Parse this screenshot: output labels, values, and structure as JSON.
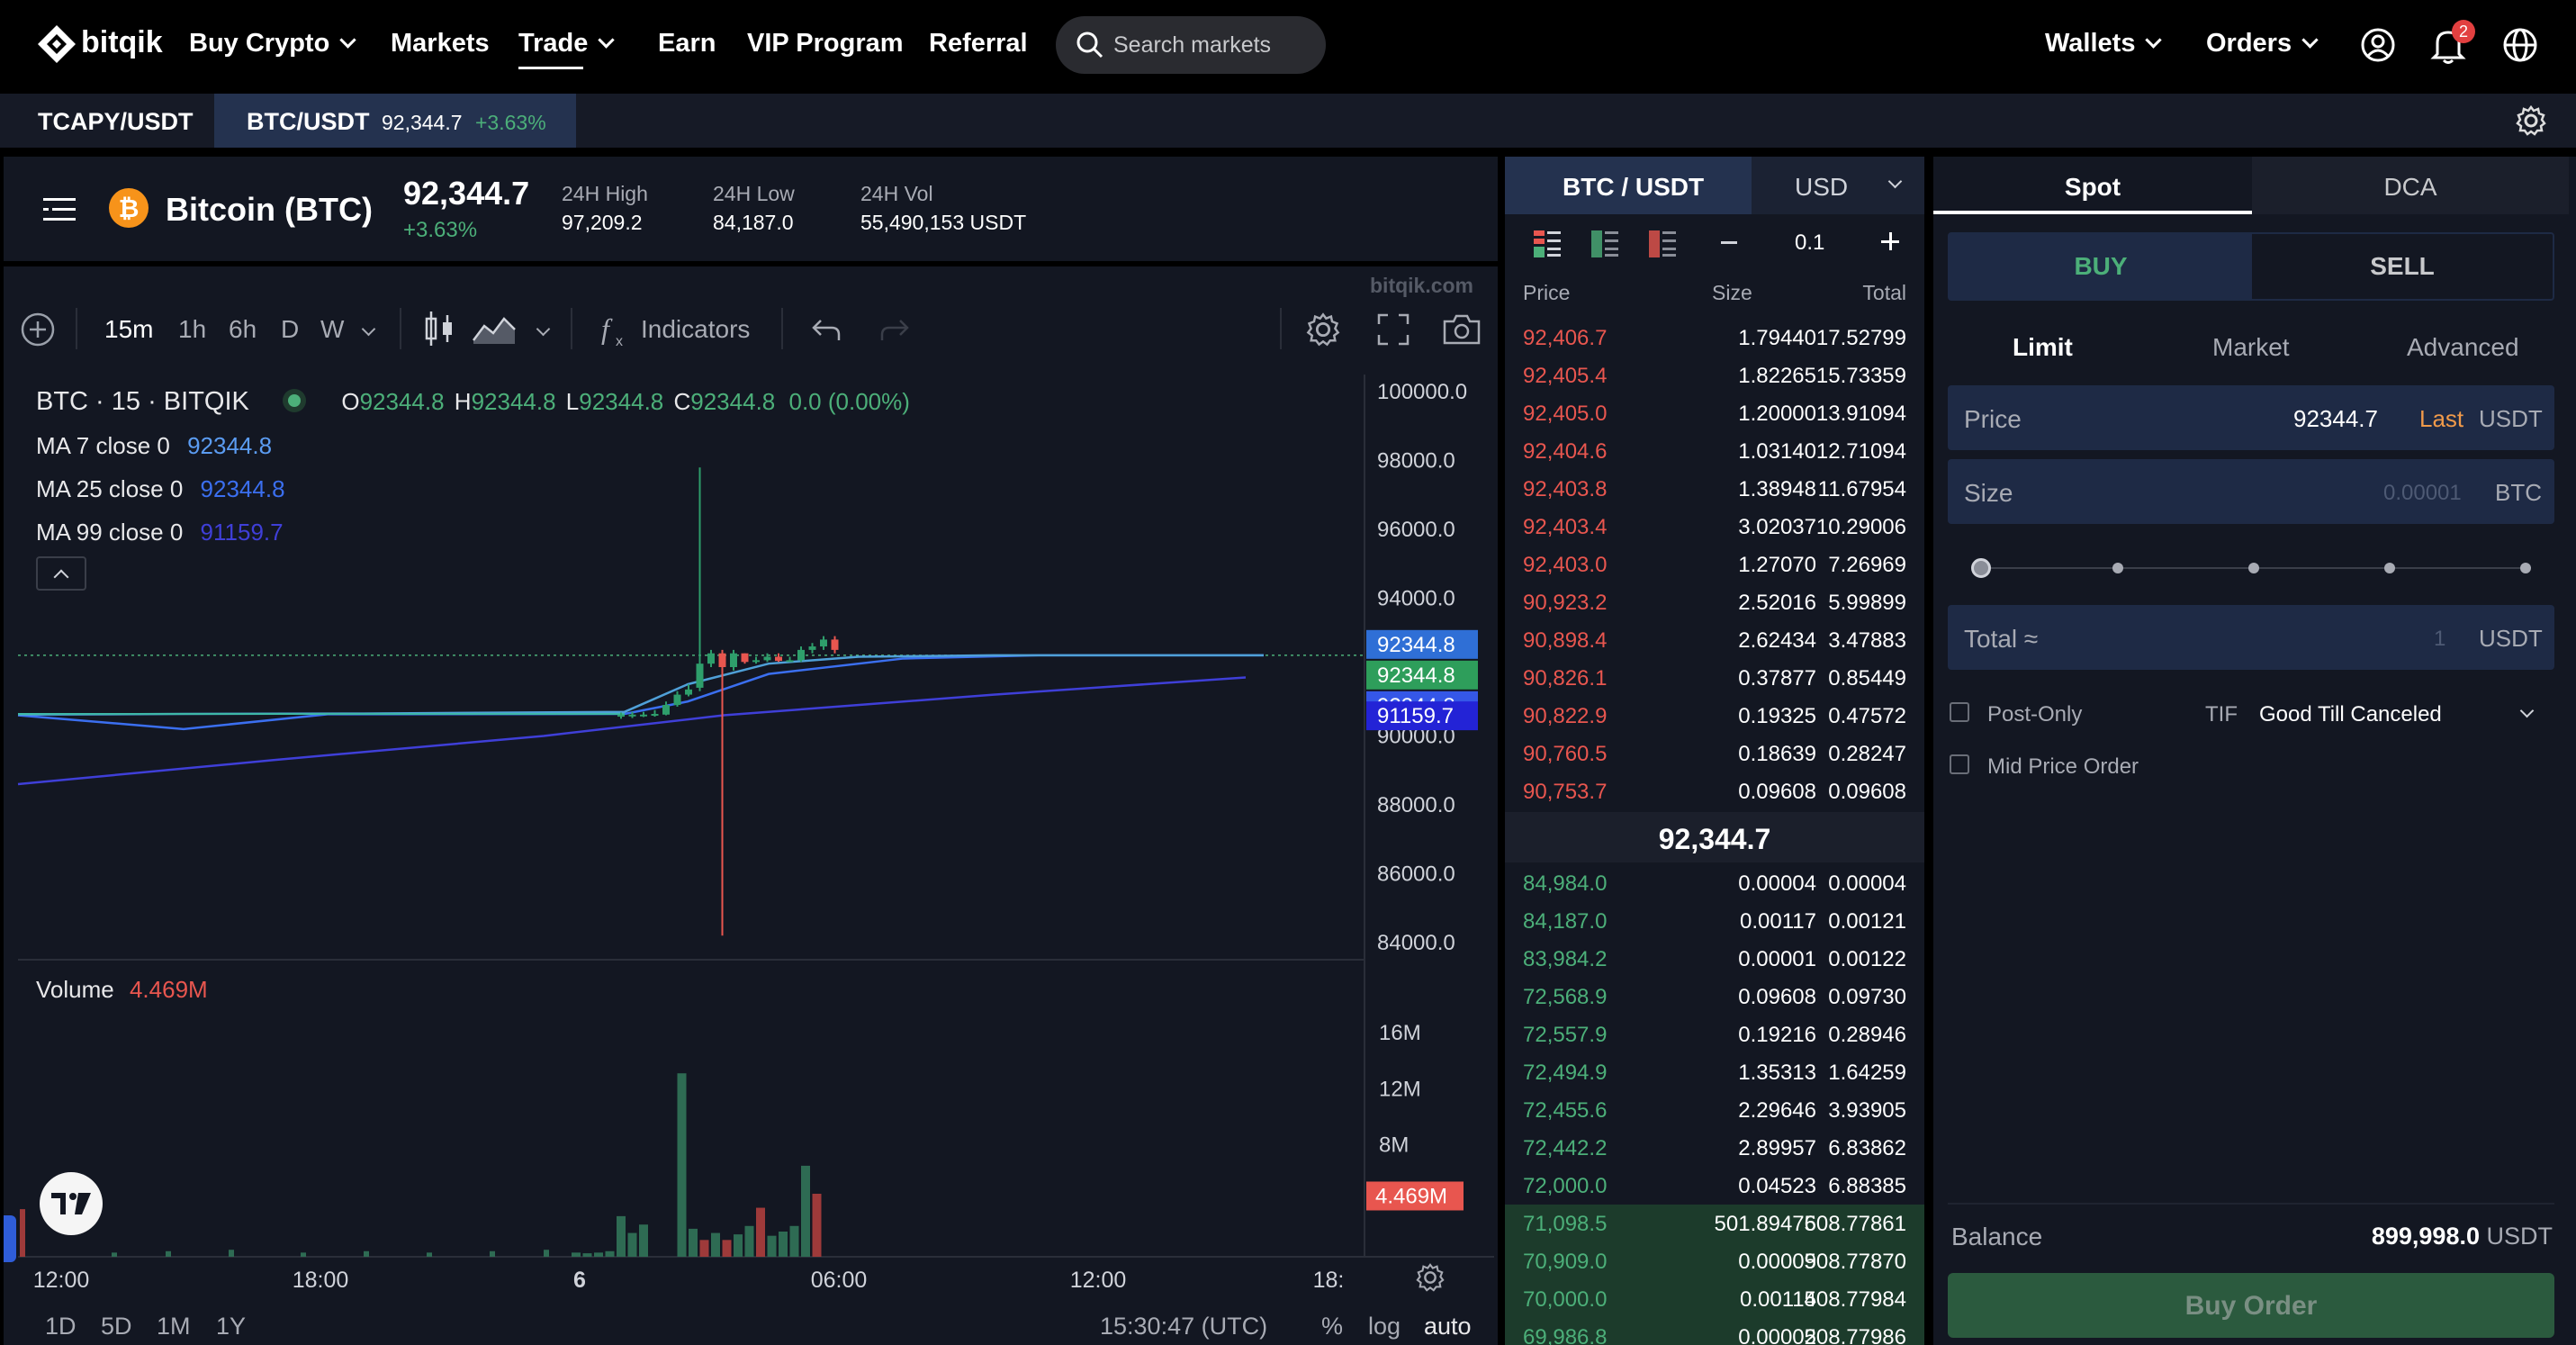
{
  "nav": {
    "logo": "bitqik",
    "items": [
      "Buy Crypto",
      "Markets",
      "Trade",
      "Earn",
      "VIP Program",
      "Referral"
    ],
    "search_placeholder": "Search markets",
    "wallets": "Wallets",
    "orders": "Orders",
    "notification_count": "2"
  },
  "tickers": [
    {
      "symbol": "TCAPY/USDT"
    },
    {
      "symbol": "BTC/USDT",
      "price": "92,344.7",
      "change": "+3.63%"
    }
  ],
  "market": {
    "name": "Bitcoin (BTC)",
    "price": "92,344.7",
    "change": "+3.63%",
    "high_label": "24H High",
    "high": "97,209.2",
    "low_label": "24H Low",
    "low": "84,187.0",
    "vol_label": "24H Vol",
    "vol": "55,490,153 USDT",
    "watermark": "bitqik.com"
  },
  "toolbar": {
    "intervals": [
      "15m",
      "1h",
      "6h",
      "D",
      "W"
    ],
    "indicators": "Indicators"
  },
  "legend": {
    "symbol": "BTC · 15 · BITQIK",
    "o_label": "O",
    "o": "92344.8",
    "h_label": "H",
    "h": "92344.8",
    "l_label": "L",
    "l": "92344.8",
    "c_label": "C",
    "c": "92344.8",
    "chg": "0.0 (0.00%)",
    "ma": [
      {
        "label": "MA 7 close 0",
        "value": "92344.8",
        "color": "#5b9cf2"
      },
      {
        "label": "MA 25 close 0",
        "value": "92344.8",
        "color": "#3b6ff0"
      },
      {
        "label": "MA 99 close 0",
        "value": "91159.7",
        "color": "#3f3fd8"
      }
    ],
    "volume_label": "Volume",
    "volume_value": "4.469M"
  },
  "chart_data": {
    "type": "candlestick",
    "y_ticks": [
      "100000.0",
      "98000.0",
      "96000.0",
      "94000.0",
      "90000.0",
      "88000.0",
      "86000.0",
      "84000.0"
    ],
    "ylim": [
      83500,
      100500
    ],
    "price_tags": [
      {
        "value": "92344.8",
        "color": "#2f6fd6"
      },
      {
        "value": "92344.8",
        "color": "#2e9e5b"
      },
      {
        "value": "92344.8",
        "color": "#3557e8"
      },
      {
        "value": "91159.7",
        "color": "#2323d6"
      }
    ],
    "x_ticks": [
      "12:00",
      "18:00",
      "6",
      "06:00",
      "12:00",
      "18:"
    ],
    "volume_ticks": [
      "16M",
      "12M",
      "8M"
    ],
    "volume_tag": "4.469M",
    "candles_close": [
      90620,
      90620,
      90620,
      90640,
      90900,
      91200,
      91350,
      92100,
      92400,
      92000,
      92400,
      92150,
      92200,
      92300,
      92180,
      92200,
      92500,
      92600,
      92800,
      92500
    ],
    "candles_open": [
      90560,
      90580,
      90600,
      90640,
      90620,
      90900,
      91200,
      91400,
      92100,
      92400,
      92000,
      92400,
      92150,
      92200,
      92300,
      92180,
      92200,
      92500,
      92600,
      92800
    ],
    "candles_high": [
      90680,
      90700,
      90700,
      90750,
      91000,
      91300,
      91500,
      97800,
      92500,
      92500,
      92500,
      92400,
      92300,
      92400,
      92400,
      92300,
      92600,
      92700,
      92900,
      92900
    ],
    "candles_low": [
      90500,
      90520,
      90550,
      90560,
      90600,
      90850,
      91150,
      91300,
      92000,
      84200,
      91900,
      92100,
      92100,
      92150,
      92150,
      92150,
      92150,
      92400,
      92500,
      92400
    ],
    "volumes": [
      0.3,
      0.25,
      0.3,
      0.4,
      2.9,
      1.7,
      2.3,
      13.1,
      2.0,
      1.2,
      1.7,
      1.2,
      1.6,
      2.2,
      3.5,
      1.5,
      1.8,
      2.2,
      6.5,
      4.5
    ]
  },
  "bottom_bar": {
    "ranges": [
      "1D",
      "5D",
      "1M",
      "1Y"
    ],
    "time": "15:30:47 (UTC)",
    "pct": "%",
    "log": "log",
    "auto": "auto"
  },
  "orderbook": {
    "pair": "BTC / USDT",
    "currency": "USD",
    "step": "0.1",
    "headers": [
      "Price",
      "Size",
      "Total"
    ],
    "asks": [
      [
        "92,406.7",
        "1.79440",
        "17.52799"
      ],
      [
        "92,405.4",
        "1.82265",
        "15.73359"
      ],
      [
        "92,405.0",
        "1.20000",
        "13.91094"
      ],
      [
        "92,404.6",
        "1.03140",
        "12.71094"
      ],
      [
        "92,403.8",
        "1.38948",
        "11.67954"
      ],
      [
        "92,403.4",
        "3.02037",
        "10.29006"
      ],
      [
        "92,403.0",
        "1.27070",
        "7.26969"
      ],
      [
        "90,923.2",
        "2.52016",
        "5.99899"
      ],
      [
        "90,898.4",
        "2.62434",
        "3.47883"
      ],
      [
        "90,826.1",
        "0.37877",
        "0.85449"
      ],
      [
        "90,822.9",
        "0.19325",
        "0.47572"
      ],
      [
        "90,760.5",
        "0.18639",
        "0.28247"
      ],
      [
        "90,753.7",
        "0.09608",
        "0.09608"
      ]
    ],
    "mid": "92,344.7",
    "bids": [
      [
        "84,984.0",
        "0.00004",
        "0.00004"
      ],
      [
        "84,187.0",
        "0.00117",
        "0.00121"
      ],
      [
        "83,984.2",
        "0.00001",
        "0.00122"
      ],
      [
        "72,568.9",
        "0.09608",
        "0.09730"
      ],
      [
        "72,557.9",
        "0.19216",
        "0.28946"
      ],
      [
        "72,494.9",
        "1.35313",
        "1.64259"
      ],
      [
        "72,455.6",
        "2.29646",
        "3.93905"
      ],
      [
        "72,442.2",
        "2.89957",
        "6.83862"
      ],
      [
        "72,000.0",
        "0.04523",
        "6.88385"
      ],
      [
        "71,098.5",
        "501.89476",
        "508.77861"
      ],
      [
        "70,909.0",
        "0.00009",
        "508.77870"
      ],
      [
        "70,000.0",
        "0.00114",
        "508.77984"
      ],
      [
        "69,986.8",
        "0.00002",
        "508.77986"
      ]
    ]
  },
  "trade": {
    "tabs": [
      "Spot",
      "DCA"
    ],
    "buy": "BUY",
    "sell": "SELL",
    "order_types": [
      "Limit",
      "Market",
      "Advanced"
    ],
    "price_label": "Price",
    "price_value": "92344.7",
    "last": "Last",
    "price_unit": "USDT",
    "size_label": "Size",
    "size_placeholder": "0.00001",
    "size_unit": "BTC",
    "total_label": "Total ≈",
    "total_placeholder": "1",
    "total_unit": "USDT",
    "post_only": "Post-Only",
    "tif_label": "TIF",
    "tif_value": "Good Till Canceled",
    "mid_price": "Mid Price Order",
    "balance_label": "Balance",
    "balance_value": "899,998.0",
    "balance_unit": "USDT",
    "submit": "Buy Order"
  }
}
